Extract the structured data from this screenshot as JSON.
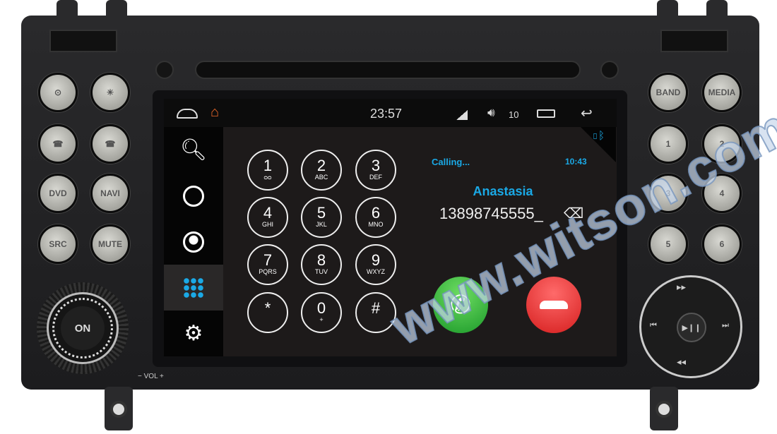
{
  "status_bar": {
    "time": "23:57",
    "volume": "10",
    "icons": [
      "home-outline-icon",
      "home-icon",
      "signal-icon",
      "volume-icon",
      "recent-apps-icon",
      "back-icon"
    ]
  },
  "sidebar": {
    "items": [
      {
        "icon": "search-icon"
      },
      {
        "icon": "clock-icon"
      },
      {
        "icon": "contact-icon"
      },
      {
        "icon": "dialpad-icon",
        "selected": true
      },
      {
        "icon": "settings-icon"
      }
    ]
  },
  "keypad": [
    {
      "d": "1",
      "l": "voicemail"
    },
    {
      "d": "2",
      "l": "ABC"
    },
    {
      "d": "3",
      "l": "DEF"
    },
    {
      "d": "4",
      "l": "GHI"
    },
    {
      "d": "5",
      "l": "JKL"
    },
    {
      "d": "6",
      "l": "MNO"
    },
    {
      "d": "7",
      "l": "PQRS"
    },
    {
      "d": "8",
      "l": "TUV"
    },
    {
      "d": "9",
      "l": "WXYZ"
    },
    {
      "d": "*",
      "l": ""
    },
    {
      "d": "0",
      "l": "+"
    },
    {
      "d": "#",
      "l": ""
    }
  ],
  "call": {
    "status": "Calling...",
    "duration": "10:43",
    "name": "Anastasia",
    "number": "13898745555_"
  },
  "hardware": {
    "left_buttons": [
      "",
      "",
      "",
      "",
      "DVD",
      "NAVI",
      "SRC",
      "MUTE"
    ],
    "right_buttons": [
      "BAND",
      "MEDIA",
      "1",
      "2",
      "3",
      "4",
      "5",
      "6"
    ],
    "power_knob": "ON",
    "volume_label": "− VOL +"
  },
  "watermark": "www.witson.com",
  "colors": {
    "accent": "#1aa9e6",
    "answer": "#2fb53a",
    "hangup": "#e52a2a"
  }
}
